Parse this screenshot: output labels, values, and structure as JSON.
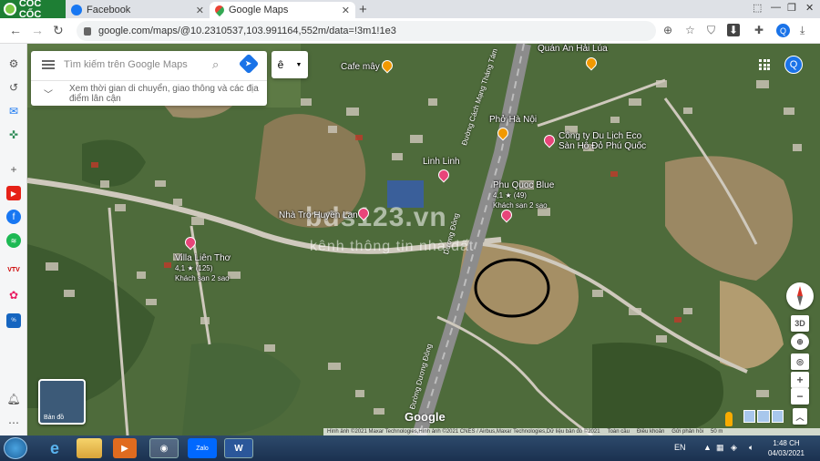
{
  "browser": {
    "brand": "CỐC CỐC",
    "tabs": [
      {
        "label": "Facebook",
        "icon": "facebook-icon"
      },
      {
        "label": "Google Maps",
        "icon": "google-maps-icon"
      }
    ],
    "url": "google.com/maps/@10.2310537,103.991164,552m/data=!3m1!1e3"
  },
  "map": {
    "search_placeholder": "Tìm kiếm trên Google Maps",
    "hint": "Xem thời gian di chuyển, giao thông và các địa điểm lân cận",
    "chip_label": "ê",
    "account_initial": "Q",
    "watermark_main": "bds123.vn",
    "watermark_sub": "kênh thông tin nhà đất",
    "pois": [
      {
        "name": "Quán Ăn Hải Lúa"
      },
      {
        "name": "Cafe mây"
      },
      {
        "name": "Phở Hà Nội"
      },
      {
        "name": "Công ty Du Lịch Eco",
        "line2": "Sàn Hô Đỏ Phú Quốc"
      },
      {
        "name": "Linh Linh"
      },
      {
        "name": "Phu Quoc Blue",
        "line2": "4,1 ★ (49)",
        "line3": "Khách sạn 2 sao"
      },
      {
        "name": "Nhà Trọ Huyền Lan"
      },
      {
        "name": "Villa Liên Thơ",
        "line2": "4,1 ★ (125)",
        "line3": "Khách sạn 2 sao"
      }
    ],
    "roads": [
      "Đường Cách Mạng Tháng Tám",
      "Dương Đông",
      "Đường Dương Đông"
    ],
    "thumbnail_label": "Bản đồ",
    "google_logo": "Google",
    "footer": [
      "Hình ảnh ©2021 Maxar Technologies,Hình ảnh ©2021 CNES / Airbus,Maxar Technologies,Dữ liệu bản đồ ©2021",
      "Toàn cầu",
      "Điều khoản",
      "Gửi phản hồi",
      "50 m"
    ],
    "controls": {
      "tilt": "3D",
      "zoom_in": "+",
      "zoom_out": "−"
    }
  },
  "taskbar": {
    "language": "EN",
    "time": "1:48 CH",
    "date": "04/03/2021"
  }
}
